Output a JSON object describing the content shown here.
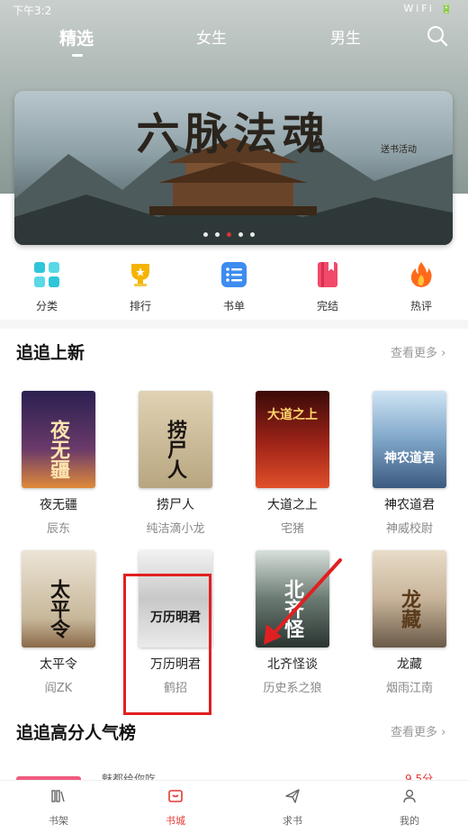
{
  "status_bar": {
    "time": "下午3:2",
    "icons": "WiFi 🔋"
  },
  "top_tabs": [
    {
      "label": "精选",
      "active": true
    },
    {
      "label": "女生",
      "active": false
    },
    {
      "label": "男生",
      "active": false
    }
  ],
  "banner": {
    "title": "六脉法魂",
    "subtitle": "送书活动",
    "dots_count": 5,
    "active_dot": 2
  },
  "quick_nav": [
    {
      "label": "分类",
      "icon": "grid-icon",
      "color": "#2ec6d8"
    },
    {
      "label": "排行",
      "icon": "trophy-icon",
      "color": "#f5b400"
    },
    {
      "label": "书单",
      "icon": "list-icon",
      "color": "#3d8cf0"
    },
    {
      "label": "完结",
      "icon": "book-icon",
      "color": "#f24a6a"
    },
    {
      "label": "热评",
      "icon": "fire-icon",
      "color": "#ff6a1a"
    }
  ],
  "section_new": {
    "title": "追追上新",
    "more": "查看更多 ›"
  },
  "books": [
    {
      "title": "夜无疆",
      "author": "辰东",
      "cover_text": "夜无疆",
      "bg": "#3a2a5e",
      "fg": "#ffd9a0"
    },
    {
      "title": "捞尸人",
      "author": "纯洁滴小龙",
      "cover_text": "捞尸人",
      "bg": "#c8b898",
      "fg": "#1a1410"
    },
    {
      "title": "大道之上",
      "author": "宅猪",
      "cover_text": "大道之上",
      "bg": "#7a1c14",
      "fg": "#ffd56a"
    },
    {
      "title": "神农道君",
      "author": "神威校尉",
      "cover_text": "神农道君",
      "bg": "#7fa6c8",
      "fg": "#ffffff"
    },
    {
      "title": "太平令",
      "author": "阎ZK",
      "cover_text": "太平令",
      "bg": "#d8ccb8",
      "fg": "#1a1410"
    },
    {
      "title": "万历明君",
      "author": "鹤招",
      "cover_text": "万历明君",
      "bg": "#d6d6d6",
      "fg": "#1a1a1a"
    },
    {
      "title": "北齐怪谈",
      "author": "历史系之狼",
      "cover_text": "北齐怪谈",
      "bg": "#4a5a52",
      "fg": "#ffffff"
    },
    {
      "title": "龙藏",
      "author": "烟雨江南",
      "cover_text": "龙藏",
      "bg": "#c8b49a",
      "fg": "#5a3a1a"
    }
  ],
  "section_rank": {
    "title": "追追高分人气榜",
    "more": "查看更多 ›"
  },
  "rank_peek": {
    "title": "魅都给你吃",
    "score": "9.5分"
  },
  "bottom_nav": [
    {
      "label": "书架",
      "icon": "bookshelf-icon",
      "active": false
    },
    {
      "label": "书城",
      "icon": "store-icon",
      "active": true
    },
    {
      "label": "求书",
      "icon": "paper-plane-icon",
      "active": false
    },
    {
      "label": "我的",
      "icon": "user-icon",
      "active": false
    }
  ],
  "colors": {
    "accent": "#e53935",
    "annotation": "#e02020"
  }
}
